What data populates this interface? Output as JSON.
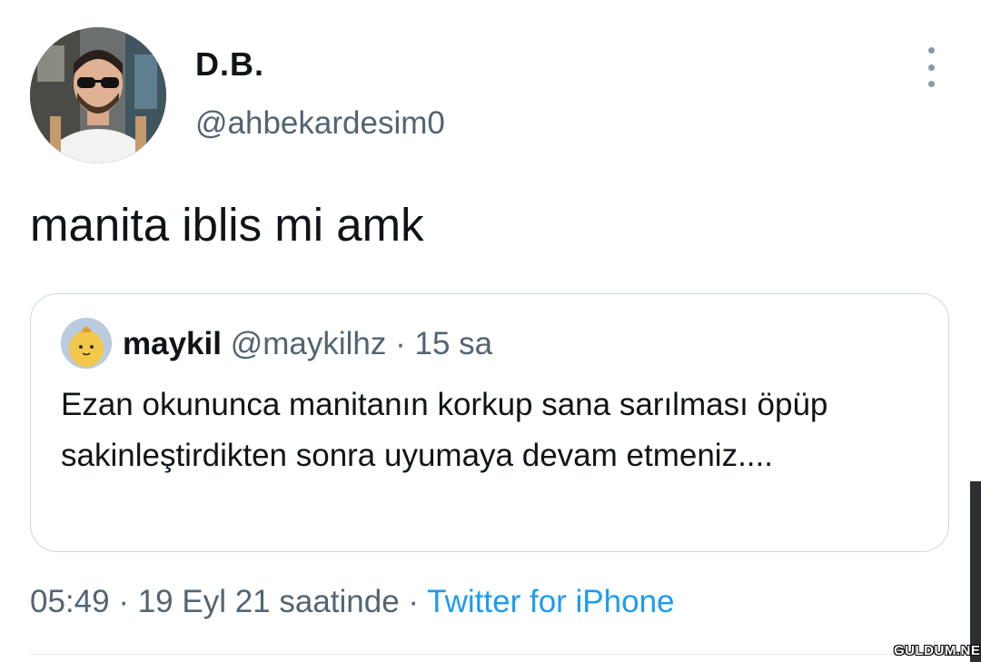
{
  "tweet": {
    "author": {
      "display_name": "D.B.",
      "handle": "@ahbekardesim0"
    },
    "text": "manita iblis mi amk",
    "more_icon": "more-vertical-icon"
  },
  "quoted_tweet": {
    "author": {
      "display_name": "maykil",
      "handle": "@maykilhz"
    },
    "separator": " · ",
    "time": "15 sa",
    "text": "Ezan okununca manitanın korkup sana sarılması öpüp sakinleştirdikten sonra uyumaya devam etmeniz...."
  },
  "footer": {
    "time": "05:49",
    "separator1": " · ",
    "date": "19 Eyl 21 saatinde",
    "separator2": " · ",
    "source": "Twitter for iPhone"
  },
  "watermark": "GULDUM.NET",
  "colors": {
    "text_primary": "#0f1419",
    "text_secondary": "#536471",
    "link": "#1d9bf0",
    "border": "#cfd9de"
  }
}
